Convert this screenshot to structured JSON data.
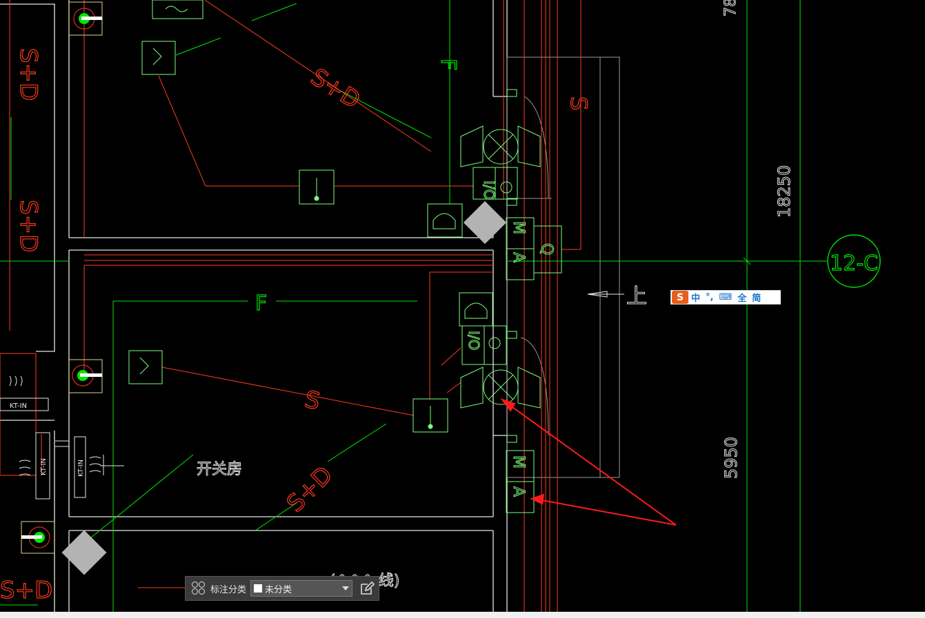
{
  "drawing": {
    "labels": {
      "sd": "S+D",
      "s": "S",
      "f": "F",
      "m": "M",
      "a": "A",
      "io": "I/O",
      "q": "Q",
      "up": "上",
      "kt": "KT-IN",
      "room": "开关房",
      "dim_top": "78",
      "dim_mid": "18250",
      "dim_low": "5950",
      "grid_axis": "12-C",
      "partial": "(^^^ 线)"
    },
    "colors": {
      "background": "#000000",
      "wall": "#ffffff",
      "fire": "#00ff00",
      "device": "#7cff7c",
      "cable": "#ff4a2a",
      "gray_block": "#b3b3b3",
      "arrow": "#ff1a1a"
    }
  },
  "ime": {
    "logo": "S",
    "items": [
      "中",
      "°,",
      "⌨",
      "全",
      "简"
    ]
  },
  "annotation_toolbar": {
    "icon": "grid-icon",
    "label": "标注分类",
    "selected": "未分类",
    "edit_icon": "edit-icon"
  }
}
